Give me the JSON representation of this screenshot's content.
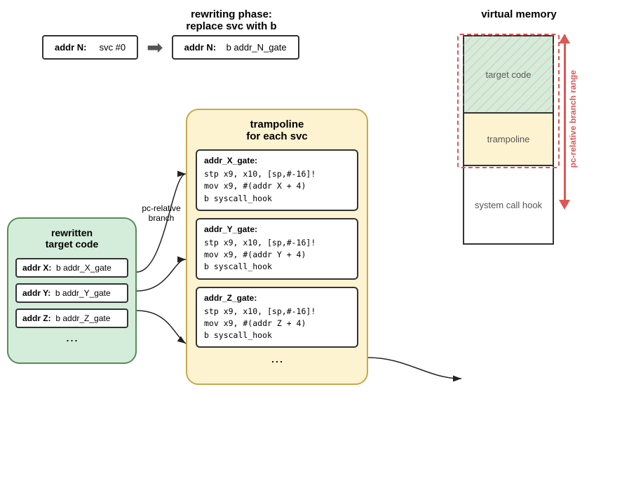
{
  "rewriting": {
    "title_line1": "rewriting phase:",
    "title_line2": "replace svc with b",
    "before_label": "addr N:",
    "before_instr": "svc #0",
    "after_label": "addr N:",
    "after_instr": "b addr_N_gate"
  },
  "rewritten": {
    "title_line1": "rewritten",
    "title_line2": "target code",
    "rows": [
      {
        "addr": "addr X:",
        "instr": "b addr_X_gate"
      },
      {
        "addr": "addr Y:",
        "instr": "b addr_Y_gate"
      },
      {
        "addr": "addr Z:",
        "instr": "b addr_Z_gate"
      }
    ],
    "dots": "⋯"
  },
  "trampoline": {
    "title_line1": "trampoline",
    "title_line2": "for each svc",
    "gates": [
      {
        "label": "addr_X_gate:",
        "lines": [
          "stp x9, x10, [sp,#-16]!",
          "mov x9, #(addr X + 4)",
          "b syscall_hook"
        ]
      },
      {
        "label": "addr_Y_gate:",
        "lines": [
          "stp x9, x10, [sp,#-16]!",
          "mov x9, #(addr Y + 4)",
          "b syscall_hook"
        ]
      },
      {
        "label": "addr_Z_gate:",
        "lines": [
          "stp x9, x10, [sp,#-16]!",
          "mov x9, #(addr Z + 4)",
          "b syscall_hook"
        ]
      }
    ],
    "dots": "⋯"
  },
  "vmem": {
    "title": "virtual memory",
    "sections": [
      {
        "label": "target code"
      },
      {
        "label": "trampoline"
      },
      {
        "label": "system call hook"
      }
    ]
  },
  "labels": {
    "pc_relative_branch": "pc-relative\nbranch",
    "pc_relative_branch_range": "pc-relative branch range"
  }
}
